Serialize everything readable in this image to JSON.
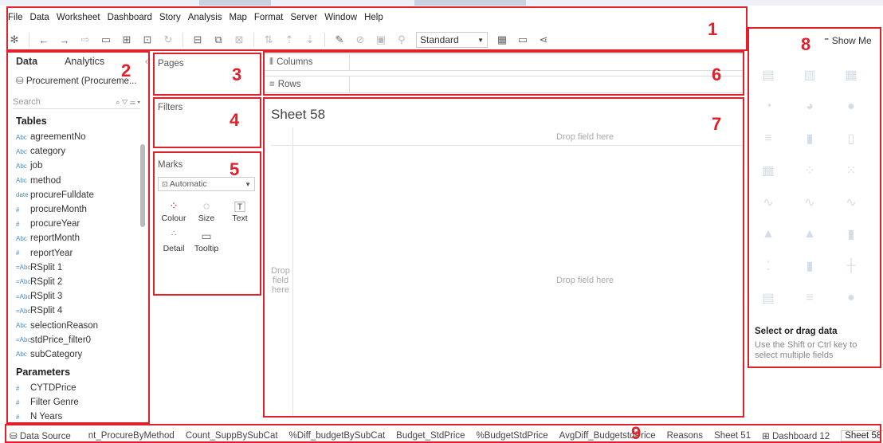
{
  "menu": [
    "File",
    "Data",
    "Worksheet",
    "Dashboard",
    "Story",
    "Analysis",
    "Map",
    "Format",
    "Server",
    "Window",
    "Help"
  ],
  "toolbar": {
    "fit_select": "Standard"
  },
  "data_pane": {
    "tabs": [
      "Data",
      "Analytics"
    ],
    "datasource": "Procurement (Procureme...",
    "search_placeholder": "Search",
    "tables_header": "Tables",
    "fields": [
      {
        "type": "Abc",
        "name": "agreementNo"
      },
      {
        "type": "Abc",
        "name": "category"
      },
      {
        "type": "Abc",
        "name": "job"
      },
      {
        "type": "Abc",
        "name": "method"
      },
      {
        "type": "date",
        "name": "procureFulldate"
      },
      {
        "type": "#",
        "name": "procureMonth"
      },
      {
        "type": "#",
        "name": "procureYear"
      },
      {
        "type": "Abc",
        "name": "reportMonth"
      },
      {
        "type": "#",
        "name": "reportYear"
      },
      {
        "type": "=Abc",
        "name": "RSplit 1"
      },
      {
        "type": "=Abc",
        "name": "RSplit 2"
      },
      {
        "type": "=Abc",
        "name": "RSplit 3"
      },
      {
        "type": "=Abc",
        "name": "RSplit 4"
      },
      {
        "type": "Abc",
        "name": "selectionReason"
      },
      {
        "type": "=Abc",
        "name": "stdPrice_filter0"
      },
      {
        "type": "Abc",
        "name": "subCategory"
      }
    ],
    "parameters_header": "Parameters",
    "parameters": [
      {
        "type": "#",
        "name": "CYTDPrice"
      },
      {
        "type": "#",
        "name": "Filter Genre"
      },
      {
        "type": "#",
        "name": "N Years"
      }
    ]
  },
  "cards": {
    "pages": "Pages",
    "filters": "Filters",
    "marks": "Marks",
    "mark_type": "Automatic",
    "mark_buttons": [
      "Colour",
      "Size",
      "Text",
      "Detail",
      "Tooltip"
    ]
  },
  "shelves": {
    "columns": "Columns",
    "rows": "Rows"
  },
  "sheet": {
    "title": "Sheet 58",
    "drop_top": "Drop field here",
    "drop_left": "Drop field here",
    "drop_center": "Drop field here"
  },
  "show_me": {
    "label": "Show Me",
    "help_title": "Select or drag data",
    "help_text": "Use the Shift or Ctrl key to select multiple fields"
  },
  "bottom_tabs": {
    "data_source": "Data Source",
    "sheets": [
      "nt_ProcureByMethod",
      "Count_SuppBySubCat",
      "%Diff_budgetBySubCat",
      "Budget_StdPrice",
      "%BudgetStdPrice",
      "AvgDiff_BudgetstdPrice",
      "Reasons",
      "Sheet 51",
      "Dashboard 12",
      "Sheet 58"
    ],
    "active": "Sheet 58"
  },
  "callouts": [
    "1",
    "2",
    "3",
    "4",
    "5",
    "6",
    "7",
    "8",
    "9"
  ],
  "colors": {
    "annotation": "#e0202a",
    "field_type": "#4c8bbf"
  }
}
